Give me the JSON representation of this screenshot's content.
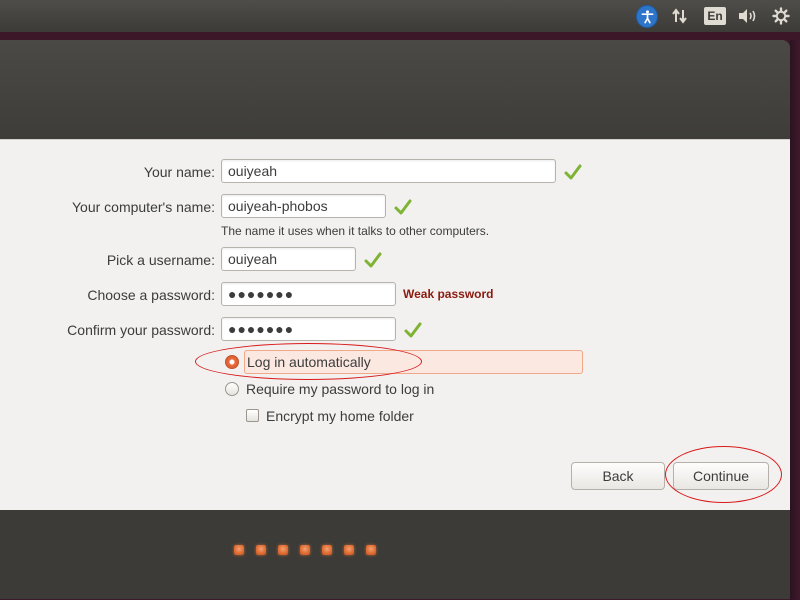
{
  "panel": {
    "icons": [
      "accessibility-icon",
      "network-icon",
      "keyboard-layout-icon",
      "sound-icon",
      "gear-icon"
    ],
    "keyboard_layout": "En",
    "accessibility_color": "#2e74c8"
  },
  "form": {
    "name": {
      "label": "Your name:",
      "value": "ouiyeah",
      "valid": true
    },
    "computer_name": {
      "label": "Your computer's name:",
      "value": "ouiyeah-phobos",
      "valid": true,
      "hint": "The name it uses when it talks to other computers."
    },
    "username": {
      "label": "Pick a username:",
      "value": "ouiyeah",
      "valid": true
    },
    "password": {
      "label": "Choose a password:",
      "value": "●●●●●●●",
      "strength": "Weak password",
      "strength_color": "#8b1a10"
    },
    "confirm": {
      "label": "Confirm your password:",
      "value": "●●●●●●●",
      "valid": true
    }
  },
  "login_options": {
    "auto_login": {
      "label": "Log in automatically",
      "selected": true
    },
    "require_password": {
      "label": "Require my password to log in",
      "selected": false
    },
    "encrypt_home": {
      "label": "Encrypt my home folder",
      "checked": false
    }
  },
  "buttons": {
    "back": "Back",
    "continue": "Continue"
  },
  "progress": {
    "steps": 7,
    "accent": "#dd6a30"
  },
  "colors": {
    "annotation": "#d91a1a",
    "check": "#7fb333",
    "body_bg": "#f2f1f0"
  }
}
